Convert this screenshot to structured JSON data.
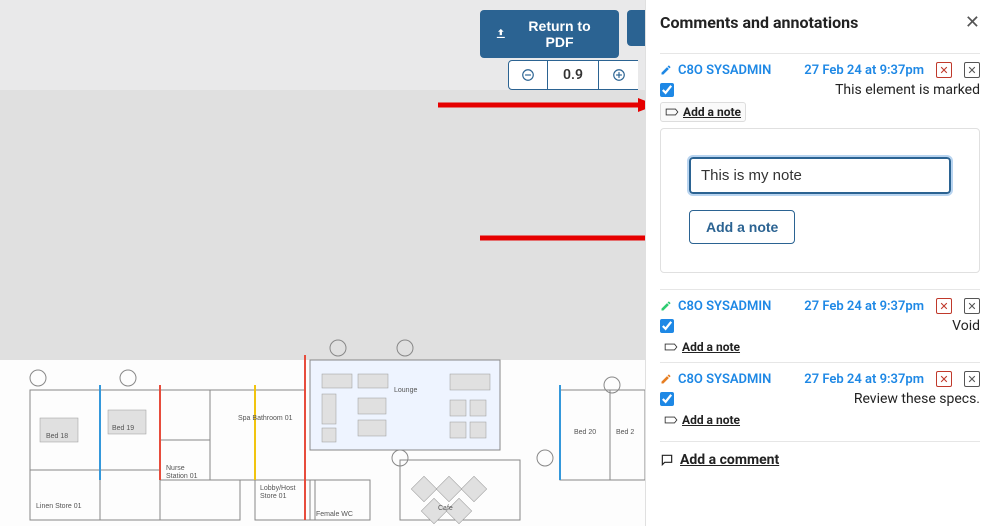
{
  "toolbar": {
    "return_label": "Return to PDF",
    "zoom_value": "0.9",
    "zoom_out": "−",
    "zoom_in": "+"
  },
  "panel": {
    "title": "Comments and annotations",
    "close": "✕",
    "annotations": [
      {
        "author": "C8O SYSADMIN",
        "date": "27 Feb 24 at 9:37pm",
        "text": "This element is marked",
        "checked": true,
        "pencil": "blue",
        "add_note_label": "Add a note"
      },
      {
        "author": "C8O SYSADMIN",
        "date": "27 Feb 24 at 9:37pm",
        "text": "Void",
        "checked": true,
        "pencil": "green",
        "add_note_label": "Add a note"
      },
      {
        "author": "C8O SYSADMIN",
        "date": "27 Feb 24 at 9:37pm",
        "text": "Review these specs.",
        "checked": true,
        "pencil": "orange",
        "add_note_label": "Add a note"
      }
    ],
    "note_editor": {
      "value": "This is my note",
      "button": "Add a note"
    },
    "add_comment": "Add a comment"
  },
  "floorplan_rooms": [
    "Bed 18",
    "Bed 19",
    "Linen Store 01",
    "Nurse Station 01",
    "Spa Bathroom 01",
    "Lobby/Host Store 01",
    "Female WC",
    "Lounge",
    "Cafe",
    "Bed 20",
    "Bed 2"
  ]
}
